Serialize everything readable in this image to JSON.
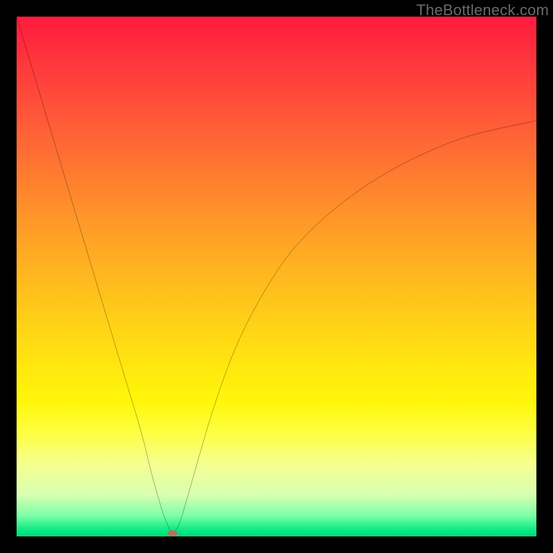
{
  "watermark": "TheBottleneck.com",
  "chart_data": {
    "type": "line",
    "title": "",
    "xlabel": "",
    "ylabel": "",
    "xlim": [
      0,
      100
    ],
    "ylim": [
      0,
      100
    ],
    "series": [
      {
        "name": "curve",
        "x": [
          0,
          3,
          6,
          9,
          12,
          15,
          18,
          21,
          24,
          26,
          28,
          29.5,
          30,
          30.5,
          31.5,
          33,
          35,
          38,
          42,
          47,
          53,
          60,
          68,
          77,
          87,
          100
        ],
        "y": [
          100,
          90,
          80,
          70,
          60,
          50,
          40,
          30,
          20,
          12,
          5,
          1.2,
          0.6,
          1.0,
          3,
          8,
          15,
          25,
          36,
          46,
          55,
          62,
          68,
          73,
          77,
          80
        ]
      }
    ],
    "marker": {
      "x": 30,
      "y": 0.6,
      "color": "#bb6f60"
    },
    "gradient_stops": [
      {
        "pos": 0,
        "color": "#ff1b3e"
      },
      {
        "pos": 50,
        "color": "#ffb81f"
      },
      {
        "pos": 75,
        "color": "#fff60a"
      },
      {
        "pos": 95,
        "color": "#9fff9f"
      },
      {
        "pos": 100,
        "color": "#00d878"
      }
    ]
  }
}
